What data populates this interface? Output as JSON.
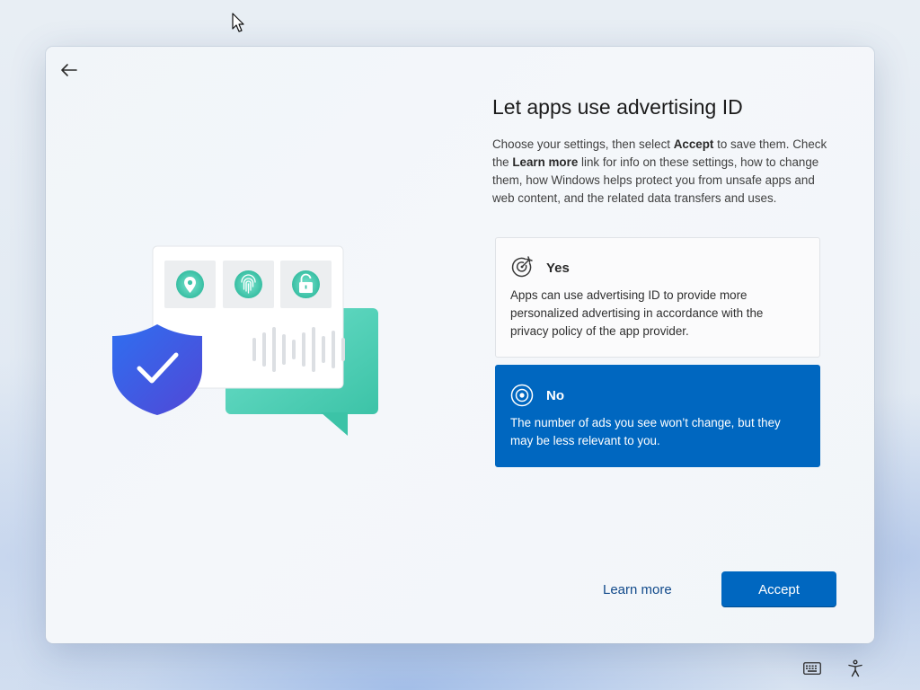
{
  "page": {
    "title": "Let apps use advertising ID",
    "description_parts": [
      "Choose your settings, then select ",
      "Accept",
      " to save them. Check the ",
      "Learn more",
      " link for info on these settings, how to change them, how Windows helps protect you from unsafe apps and web content, and the related data transfers and uses."
    ]
  },
  "options": [
    {
      "label": "Yes",
      "body": "Apps can use advertising ID to provide more personalized advertising in accordance with the privacy policy of the app provider.",
      "selected": false,
      "icon": "target-icon"
    },
    {
      "label": "No",
      "body": "The number of ads you see won’t change, but they may be less relevant to you.",
      "selected": true,
      "icon": "radio-target-icon"
    }
  ],
  "footer": {
    "learn_more_label": "Learn more",
    "accept_label": "Accept"
  },
  "nav": {
    "back_icon": "back-arrow-icon"
  },
  "tray": {
    "keyboard_icon": "keyboard-icon",
    "accessibility_icon": "accessibility-icon"
  },
  "illustration": {
    "tiles": [
      "location-pin-icon",
      "fingerprint-icon",
      "unlocked-padlock-icon"
    ],
    "badge": "shield-check-icon"
  },
  "colors": {
    "accent": "#0067c0",
    "link": "#114a8b",
    "teal": "#4fd1b8",
    "shield": "#3b5fe0"
  }
}
